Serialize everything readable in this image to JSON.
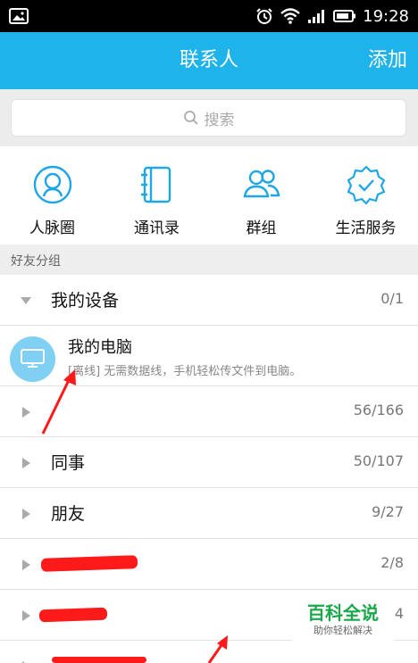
{
  "status_bar": {
    "time": "19:28"
  },
  "header": {
    "title": "联系人",
    "add_label": "添加"
  },
  "search": {
    "placeholder": "搜索"
  },
  "shortcuts": [
    {
      "label": "人脉圈",
      "icon": "person-circle-icon"
    },
    {
      "label": "通讯录",
      "icon": "address-book-icon"
    },
    {
      "label": "群组",
      "icon": "group-icon"
    },
    {
      "label": "生活服务",
      "icon": "service-badge-icon"
    }
  ],
  "friends_section": {
    "label": "好友分组"
  },
  "groups": [
    {
      "name": "我的设备",
      "count": "0/1",
      "expanded": true
    },
    {
      "name": "",
      "count": "56/166",
      "expanded": false
    },
    {
      "name": "同事",
      "count": "50/107",
      "expanded": false
    },
    {
      "name": "朋友",
      "count": "9/27",
      "expanded": false
    },
    {
      "name": "",
      "count": "2/8",
      "expanded": false
    },
    {
      "name": "",
      "count": "4",
      "expanded": false
    }
  ],
  "device": {
    "name": "我的电脑",
    "status": "[离线] 无需数据线，手机轻松传文件到电脑。"
  },
  "watermark": {
    "title": "百科全说",
    "subtitle": "助你轻松解决"
  },
  "colors": {
    "accent": "#1fb3ec",
    "redaction": "#ff1a1a",
    "watermark": "#19a84a"
  }
}
